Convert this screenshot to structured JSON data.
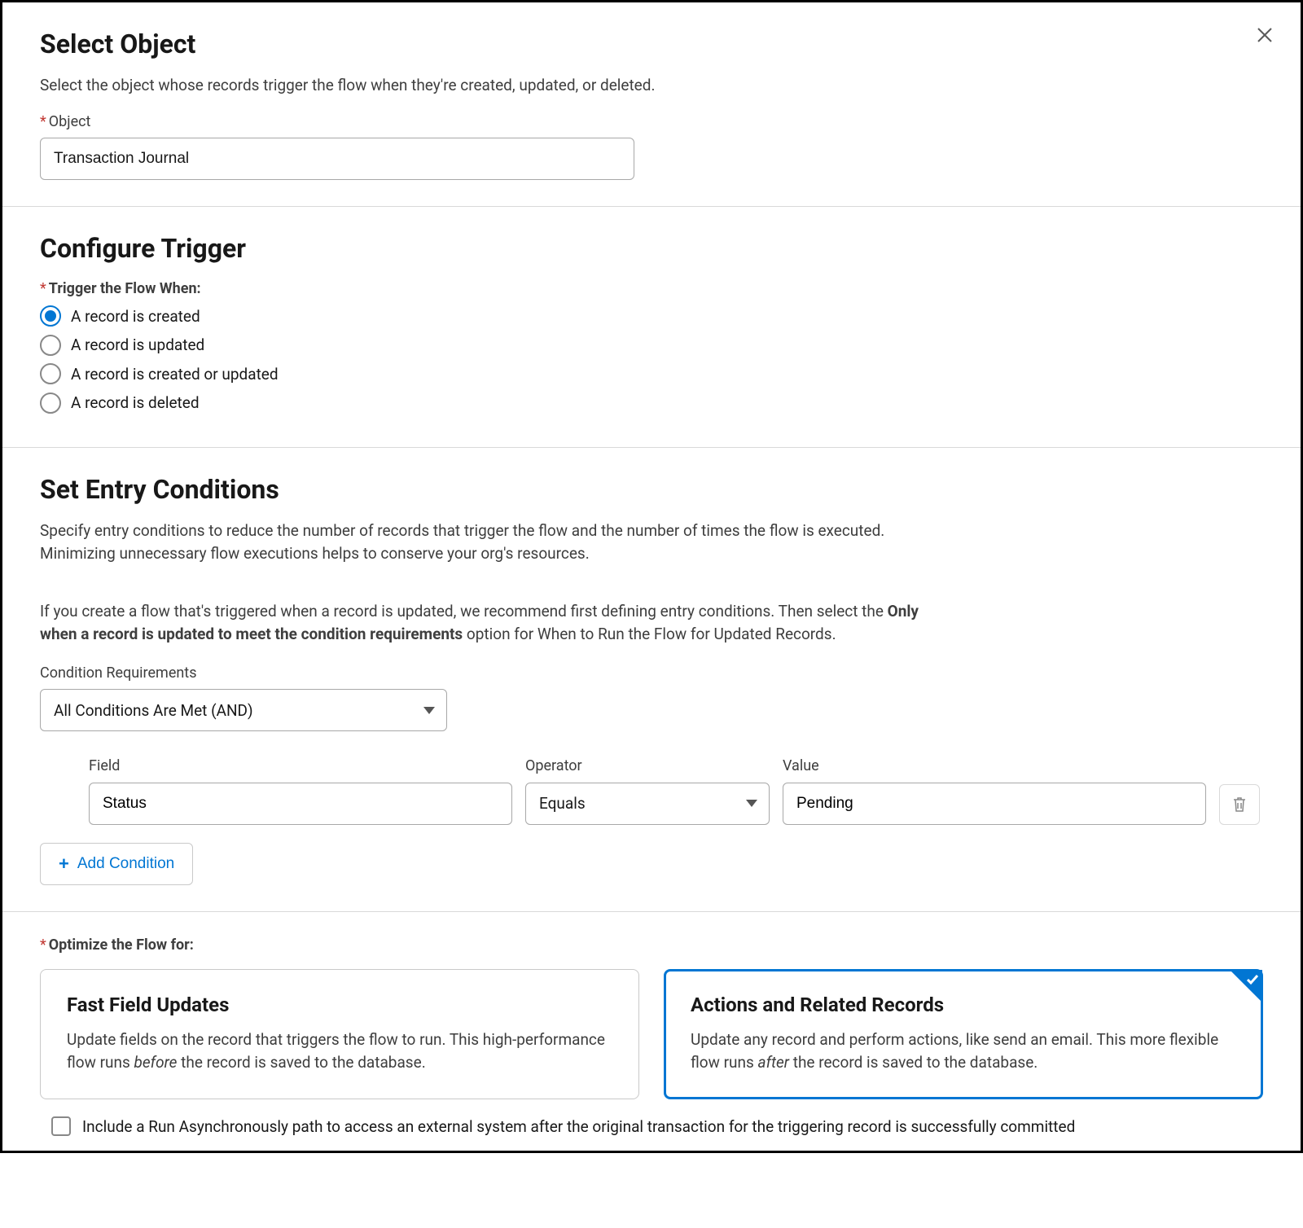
{
  "close_icon": "close",
  "select_object": {
    "title": "Select Object",
    "desc": "Select the object whose records trigger the flow when they're created, updated, or deleted.",
    "object_label": "Object",
    "object_value": "Transaction Journal"
  },
  "configure_trigger": {
    "title": "Configure Trigger",
    "trigger_label": "Trigger the Flow When:",
    "options": [
      "A record is created",
      "A record is updated",
      "A record is created or updated",
      "A record is deleted"
    ],
    "selected_index": 0
  },
  "entry_conditions": {
    "title": "Set Entry Conditions",
    "desc1": "Specify entry conditions to reduce the number of records that trigger the flow and the number of times the flow is executed. Minimizing unnecessary flow executions helps to conserve your org's resources.",
    "desc2_pre": "If you create a flow that's triggered when a record is updated, we recommend first defining entry conditions. Then select the ",
    "desc2_bold": "Only when a record is updated to meet the condition requirements",
    "desc2_post": " option for When to Run the Flow for Updated Records.",
    "cond_req_label": "Condition Requirements",
    "cond_req_value": "All Conditions Are Met (AND)",
    "field_label": "Field",
    "operator_label": "Operator",
    "value_label": "Value",
    "field_value": "Status",
    "operator_value": "Equals",
    "value_value": "Pending",
    "add_condition": "Add Condition"
  },
  "optimize": {
    "label": "Optimize the Flow for:",
    "cards": [
      {
        "title": "Fast Field Updates",
        "desc_pre": "Update fields on the record that triggers the flow to run. This high-performance flow runs ",
        "desc_em": "before",
        "desc_post": " the record is saved to the database."
      },
      {
        "title": "Actions and Related Records",
        "desc_pre": "Update any record and perform actions, like send an email. This more flexible flow runs ",
        "desc_em": "after",
        "desc_post": " the record is saved to the database."
      }
    ],
    "selected_index": 1,
    "async_checkbox": "Include a Run Asynchronously path to access an external system after the original transaction for the triggering record is successfully committed"
  }
}
